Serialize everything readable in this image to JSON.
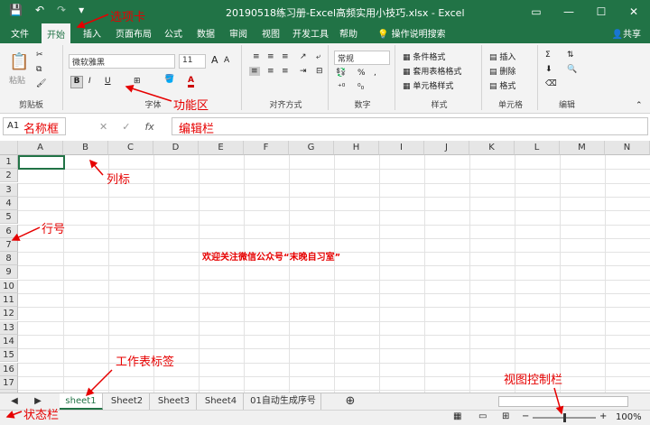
{
  "window": {
    "title": "20190518练习册-Excel高频实用小技巧.xlsx  -  Excel",
    "controls": [
      "▭",
      "—",
      "☐",
      "✕"
    ]
  },
  "qat": [
    "💾",
    "↶",
    "↷",
    "▾"
  ],
  "tabs": [
    "文件",
    "开始",
    "插入",
    "页面布局",
    "公式",
    "数据",
    "审阅",
    "视图",
    "开发工具",
    "帮助"
  ],
  "tellme": "操作说明搜索",
  "share": "共享",
  "ribbon": {
    "clipboard": {
      "paste": "粘贴",
      "label": "剪贴板"
    },
    "font": {
      "name": "微软雅黑",
      "size": "11",
      "label": "字体",
      "bold": "B",
      "italic": "I",
      "underline": "U"
    },
    "alignment": {
      "label": "对齐方式"
    },
    "number": {
      "format": "常规",
      "label": "数字"
    },
    "styles": {
      "items": [
        "条件格式",
        "套用表格格式",
        "单元格样式"
      ],
      "label": "样式"
    },
    "cells": {
      "items": [
        "插入",
        "删除",
        "格式"
      ],
      "label": "单元格"
    },
    "editing": {
      "label": "编辑"
    }
  },
  "formula": {
    "namebox": "A1",
    "fx": "fx"
  },
  "columns": [
    "A",
    "B",
    "C",
    "D",
    "E",
    "F",
    "G",
    "H",
    "I",
    "J",
    "K",
    "L",
    "M",
    "N"
  ],
  "rows": [
    "1",
    "2",
    "3",
    "4",
    "5",
    "6",
    "7",
    "8",
    "9",
    "10",
    "11",
    "12",
    "13",
    "14",
    "15",
    "16",
    "17",
    "18"
  ],
  "sheets": [
    "sheet1",
    "Sheet2",
    "Sheet3",
    "Sheet4",
    "01自动生成序号"
  ],
  "status": {
    "zoom": "100%"
  },
  "annotations": {
    "tabs": "选项卡",
    "ribbon": "功能区",
    "namebox": "名称框",
    "formulabar": "编辑栏",
    "column": "列标",
    "row": "行号",
    "sheettab": "工作表标签",
    "viewcontrol": "视图控制栏",
    "statusbar": "状态栏"
  },
  "watermark": "欢迎关注微信公众号“末晚自习室”",
  "colors": {
    "excel_green": "#217346",
    "annotation_red": "#e60000"
  }
}
